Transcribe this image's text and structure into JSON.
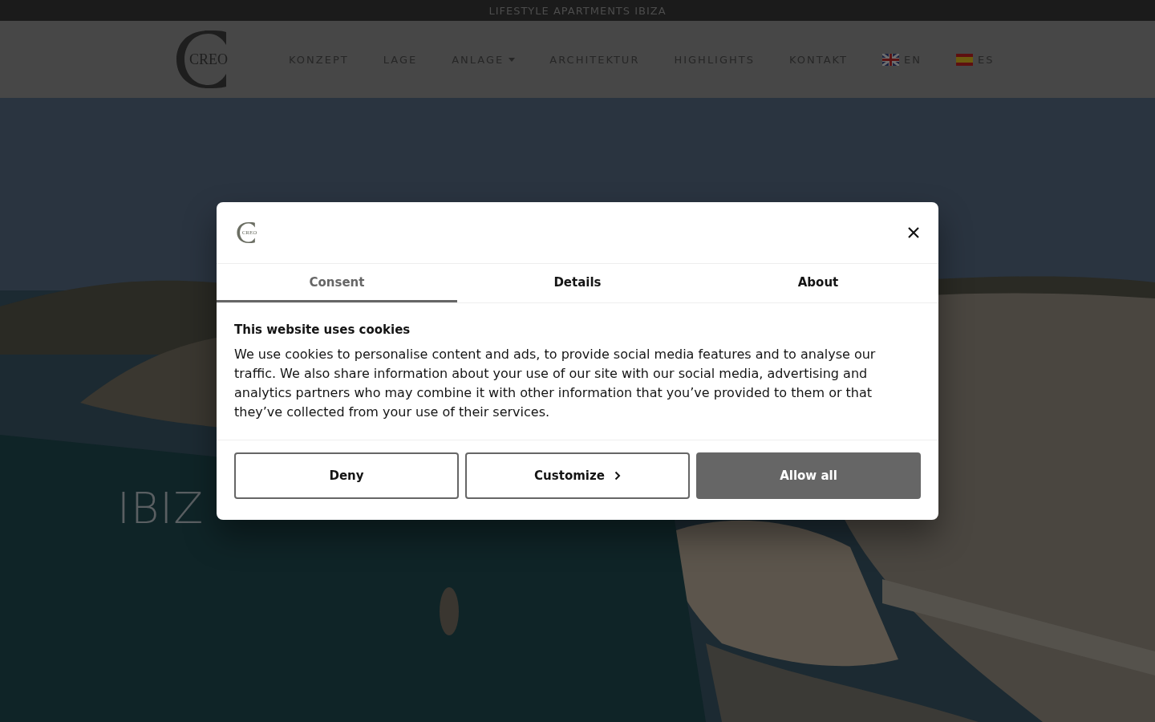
{
  "top_bar": {
    "text": "LIFESTYLE APARTMENTS IBIZA"
  },
  "header": {
    "logo": "CREO",
    "nav": [
      {
        "label": "KONZEPT",
        "kind": "link"
      },
      {
        "label": "LAGE",
        "kind": "link"
      },
      {
        "label": "ANLAGE",
        "kind": "dropdown"
      },
      {
        "label": "ARCHITEKTUR",
        "kind": "link"
      },
      {
        "label": "HIGHLIGHTS",
        "kind": "link"
      },
      {
        "label": "KONTAKT",
        "kind": "link"
      },
      {
        "label": "EN",
        "kind": "flag_uk"
      },
      {
        "label": "ES",
        "kind": "flag_es"
      }
    ]
  },
  "hero": {
    "title": "IBIZ"
  },
  "cookie_dialog": {
    "logo": "CREO",
    "tabs": [
      {
        "label": "Consent",
        "selected": true
      },
      {
        "label": "Details",
        "selected": false
      },
      {
        "label": "About",
        "selected": false
      }
    ],
    "title": "This website uses cookies",
    "text": "We use cookies to personalise content and ads, to provide social media features and to analyse our traffic. We also share information about your use of our site with our social media, advertising and analytics partners who may combine it with other information that you’ve provided to them or that they’ve collected from your use of their services.",
    "buttons": [
      {
        "label": "Deny",
        "kind": "outline"
      },
      {
        "label": "Customize",
        "kind": "chevron"
      },
      {
        "label": "Allow all",
        "kind": "primary"
      }
    ]
  }
}
